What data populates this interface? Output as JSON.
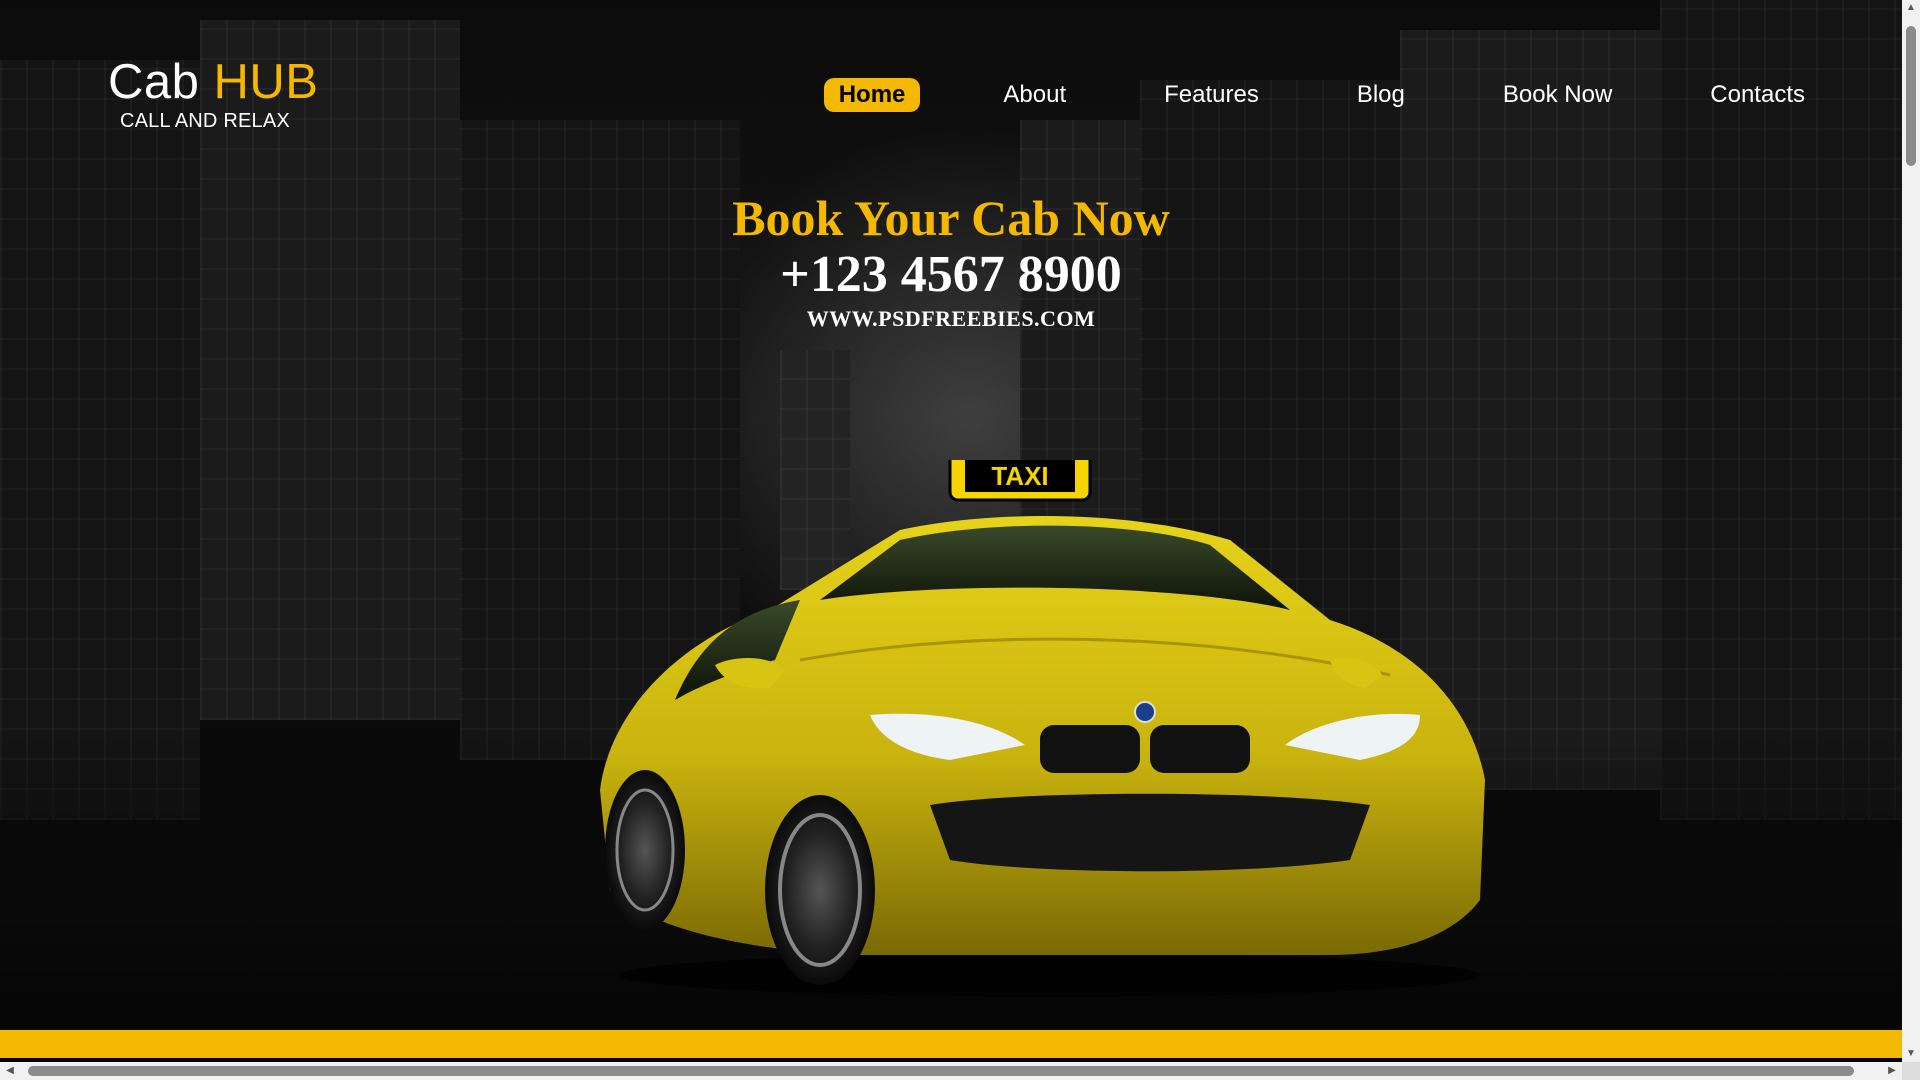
{
  "logo": {
    "brand_part1": "Cab",
    "brand_part2": "HUB",
    "tagline": "CALL AND RELAX"
  },
  "nav": {
    "items": [
      {
        "label": "Home",
        "active": true
      },
      {
        "label": "About",
        "active": false
      },
      {
        "label": "Features",
        "active": false
      },
      {
        "label": "Blog",
        "active": false
      },
      {
        "label": "Book Now",
        "active": false
      },
      {
        "label": "Contacts",
        "active": false
      }
    ]
  },
  "hero": {
    "title": "Book Your Cab Now",
    "phone": "+123 4567 8900",
    "website": "WWW.PSDFREEBIES.COM",
    "taxi_sign": "TAXI"
  },
  "colors": {
    "accent": "#f5b800",
    "background": "#000000",
    "text": "#ffffff"
  },
  "icons": {
    "scroll_up": "chevron-up-icon",
    "scroll_down": "chevron-down-icon",
    "scroll_left": "chevron-left-icon",
    "scroll_right": "chevron-right-icon"
  }
}
